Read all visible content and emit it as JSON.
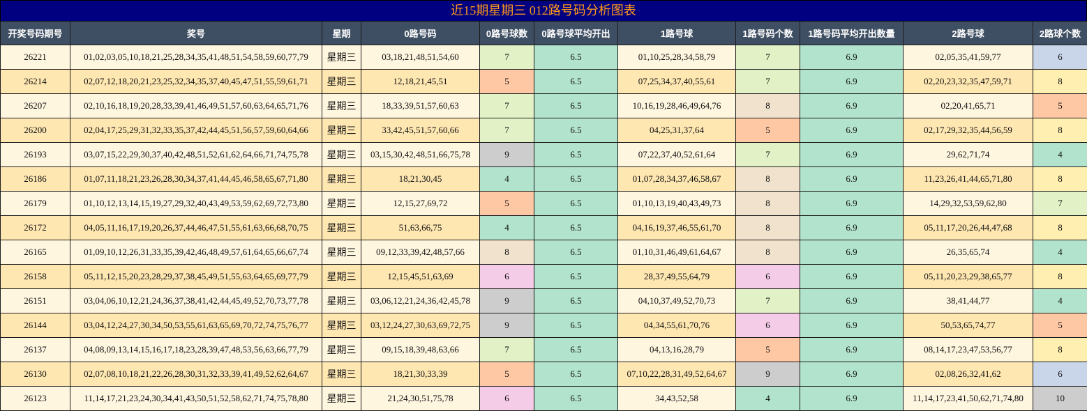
{
  "title": "近15期星期三 012路号码分析图表",
  "headers": [
    "开奖号码期号",
    "奖号",
    "星期",
    "0路号码",
    "0路号球数",
    "0路号球平均开出",
    "1路号球",
    "1路号码个数",
    "1路号码平均开出数量",
    "2路号球",
    "2路球个数"
  ],
  "colors": {
    "title_bg": "#000080",
    "title_text": "#ff9a1a",
    "header_bg": "#3f4f63",
    "row_odd": "#fff6e0",
    "row_even": "#ffe7b2",
    "average": "#b2e3cd",
    "count_4": "#b2e3cd",
    "count_5": "#ffc8a4",
    "count_6": "#f5cce8",
    "count_7": "#e2f2c6",
    "count_8": "#f0e2cc",
    "count_9": "#cdcdcd"
  },
  "rows": [
    {
      "period": "26221",
      "numbers": "01,02,03,05,10,18,21,25,28,34,35,41,48,51,54,58,59,60,77,79",
      "weekday": "星期三",
      "zero_nums": "03,18,21,48,51,54,60",
      "zero_count": "7",
      "zero_avg": "6.5",
      "one_nums": "01,10,25,28,34,58,79",
      "one_count": "7",
      "one_avg": "6.9",
      "two_nums": "02,05,35,41,59,77",
      "two_count": "6",
      "two_bg": "#c9d5e9"
    },
    {
      "period": "26214",
      "numbers": "02,07,12,18,20,21,23,25,32,34,35,37,40,45,47,51,55,59,61,71",
      "weekday": "星期三",
      "zero_nums": "12,18,21,45,51",
      "zero_count": "5",
      "zero_avg": "6.5",
      "one_nums": "07,25,34,37,40,55,61",
      "one_count": "7",
      "one_avg": "6.9",
      "two_nums": "02,20,23,32,35,47,59,71",
      "two_count": "8",
      "two_bg": "#ffefb0"
    },
    {
      "period": "26207",
      "numbers": "02,10,16,18,19,20,28,33,39,41,46,49,51,57,60,63,64,65,71,76",
      "weekday": "星期三",
      "zero_nums": "18,33,39,51,57,60,63",
      "zero_count": "7",
      "zero_avg": "6.5",
      "one_nums": "10,16,19,28,46,49,64,76",
      "one_count": "8",
      "one_avg": "6.9",
      "two_nums": "02,20,41,65,71",
      "two_count": "5",
      "two_bg": "#ffc8a4"
    },
    {
      "period": "26200",
      "numbers": "02,04,17,25,29,31,32,33,35,37,42,44,45,51,56,57,59,60,64,66",
      "weekday": "星期三",
      "zero_nums": "33,42,45,51,57,60,66",
      "zero_count": "7",
      "zero_avg": "6.5",
      "one_nums": "04,25,31,37,64",
      "one_count": "5",
      "one_avg": "6.9",
      "two_nums": "02,17,29,32,35,44,56,59",
      "two_count": "8",
      "two_bg": "#ffefb0"
    },
    {
      "period": "26193",
      "numbers": "03,07,15,22,29,30,37,40,42,48,51,52,61,62,64,66,71,74,75,78",
      "weekday": "星期三",
      "zero_nums": "03,15,30,42,48,51,66,75,78",
      "zero_count": "9",
      "zero_avg": "6.5",
      "one_nums": "07,22,37,40,52,61,64",
      "one_count": "7",
      "one_avg": "6.9",
      "two_nums": "29,62,71,74",
      "two_count": "4",
      "two_bg": "#b2e3cd"
    },
    {
      "period": "26186",
      "numbers": "01,07,11,18,21,23,26,28,30,34,37,41,44,45,46,58,65,67,71,80",
      "weekday": "星期三",
      "zero_nums": "18,21,30,45",
      "zero_count": "4",
      "zero_avg": "6.5",
      "one_nums": "01,07,28,34,37,46,58,67",
      "one_count": "8",
      "one_avg": "6.9",
      "two_nums": "11,23,26,41,44,65,71,80",
      "two_count": "8",
      "two_bg": "#ffefb0"
    },
    {
      "period": "26179",
      "numbers": "01,10,12,13,14,15,19,27,29,32,40,43,49,53,59,62,69,72,73,80",
      "weekday": "星期三",
      "zero_nums": "12,15,27,69,72",
      "zero_count": "5",
      "zero_avg": "6.5",
      "one_nums": "01,10,13,19,40,43,49,73",
      "one_count": "8",
      "one_avg": "6.9",
      "two_nums": "14,29,32,53,59,62,80",
      "two_count": "7",
      "two_bg": "#e2f2c6"
    },
    {
      "period": "26172",
      "numbers": "04,05,11,16,17,19,20,26,37,44,46,47,51,55,61,63,66,68,70,75",
      "weekday": "星期三",
      "zero_nums": "51,63,66,75",
      "zero_count": "4",
      "zero_avg": "6.5",
      "one_nums": "04,16,19,37,46,55,61,70",
      "one_count": "8",
      "one_avg": "6.9",
      "two_nums": "05,11,17,20,26,44,47,68",
      "two_count": "8",
      "two_bg": "#ffefb0"
    },
    {
      "period": "26165",
      "numbers": "01,09,10,12,26,31,33,35,39,42,46,48,49,57,61,64,65,66,67,74",
      "weekday": "星期三",
      "zero_nums": "09,12,33,39,42,48,57,66",
      "zero_count": "8",
      "zero_avg": "6.5",
      "one_nums": "01,10,31,46,49,61,64,67",
      "one_count": "8",
      "one_avg": "6.9",
      "two_nums": "26,35,65,74",
      "two_count": "4",
      "two_bg": "#b2e3cd"
    },
    {
      "period": "26158",
      "numbers": "05,11,12,15,20,23,28,29,37,38,45,49,51,55,63,64,65,69,77,79",
      "weekday": "星期三",
      "zero_nums": "12,15,45,51,63,69",
      "zero_count": "6",
      "zero_avg": "6.5",
      "one_nums": "28,37,49,55,64,79",
      "one_count": "6",
      "one_avg": "6.9",
      "two_nums": "05,11,20,23,29,38,65,77",
      "two_count": "8",
      "two_bg": "#ffefb0"
    },
    {
      "period": "26151",
      "numbers": "03,04,06,10,12,21,24,36,37,38,41,42,44,45,49,52,70,73,77,78",
      "weekday": "星期三",
      "zero_nums": "03,06,12,21,24,36,42,45,78",
      "zero_count": "9",
      "zero_avg": "6.5",
      "one_nums": "04,10,37,49,52,70,73",
      "one_count": "7",
      "one_avg": "6.9",
      "two_nums": "38,41,44,77",
      "two_count": "4",
      "two_bg": "#b2e3cd"
    },
    {
      "period": "26144",
      "numbers": "03,04,12,24,27,30,34,50,53,55,61,63,65,69,70,72,74,75,76,77",
      "weekday": "星期三",
      "zero_nums": "03,12,24,27,30,63,69,72,75",
      "zero_count": "9",
      "zero_avg": "6.5",
      "one_nums": "04,34,55,61,70,76",
      "one_count": "6",
      "one_avg": "6.9",
      "two_nums": "50,53,65,74,77",
      "two_count": "5",
      "two_bg": "#ffc8a4"
    },
    {
      "period": "26137",
      "numbers": "04,08,09,13,14,15,16,17,18,23,28,39,47,48,53,56,63,66,77,79",
      "weekday": "星期三",
      "zero_nums": "09,15,18,39,48,63,66",
      "zero_count": "7",
      "zero_avg": "6.5",
      "one_nums": "04,13,16,28,79",
      "one_count": "5",
      "one_avg": "6.9",
      "two_nums": "08,14,17,23,47,53,56,77",
      "two_count": "8",
      "two_bg": "#ffefb0"
    },
    {
      "period": "26130",
      "numbers": "02,07,08,10,18,21,22,26,28,30,31,32,33,39,41,49,52,62,64,67",
      "weekday": "星期三",
      "zero_nums": "18,21,30,33,39",
      "zero_count": "5",
      "zero_avg": "6.5",
      "one_nums": "07,10,22,28,31,49,52,64,67",
      "one_count": "9",
      "one_avg": "6.9",
      "two_nums": "02,08,26,32,41,62",
      "two_count": "6",
      "two_bg": "#c9d5e9"
    },
    {
      "period": "26123",
      "numbers": "11,14,17,21,23,24,30,34,41,43,50,51,52,58,62,71,74,75,78,80",
      "weekday": "星期三",
      "zero_nums": "21,24,30,51,75,78",
      "zero_count": "6",
      "zero_avg": "6.5",
      "one_nums": "34,43,52,58",
      "one_count": "4",
      "one_avg": "6.9",
      "two_nums": "11,14,17,23,41,50,62,71,74,80",
      "two_count": "10",
      "two_bg": "#cdcdcd"
    }
  ]
}
